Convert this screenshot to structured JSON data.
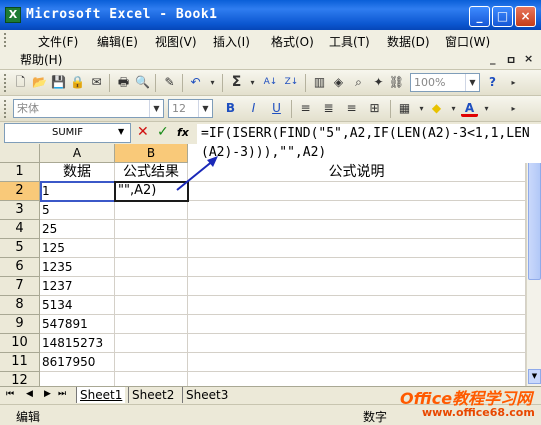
{
  "window": {
    "title": "Microsoft Excel - Book1",
    "icon": "excel-icon",
    "buttons": [
      "_",
      "□",
      "×"
    ]
  },
  "menubar": {
    "items": [
      "文件(F)",
      "编辑(E)",
      "视图(V)",
      "插入(I)",
      "格式(O)",
      "工具(T)",
      "数据(D)",
      "窗口(W)",
      "帮助(H)"
    ],
    "mdi_buttons": [
      "_",
      "ㅁ",
      "×"
    ]
  },
  "toolbar_standard": {
    "icons": [
      "new-icon",
      "open-icon",
      "save-icon",
      "permission-icon",
      "print-icon",
      "print-preview-icon",
      "format-painter-icon",
      "undo-icon",
      "autosum-icon",
      "sort-ascending-icon",
      "sort-descending-icon",
      "chart-wizard-icon",
      "drawing-icon",
      "help-icon"
    ],
    "zoom": "100%"
  },
  "toolbar_formatting": {
    "font": "宋体",
    "size": "12",
    "bold": "B",
    "italic": "I",
    "underline": "U",
    "font_color": "A"
  },
  "formula_bar": {
    "name_box": "SUMIF",
    "cancel": "✕",
    "enter": "✓",
    "fx": "fx",
    "formula": "=IF(ISERR(FIND(\"5\",A2,IF(LEN(A2)-3<1,1,LEN(A2)-3))),\"\",A2)"
  },
  "sheet": {
    "columns": [
      "A",
      "B"
    ],
    "rows": [
      "1",
      "2",
      "3",
      "4",
      "5",
      "6",
      "7",
      "8",
      "9",
      "10",
      "11",
      "12"
    ],
    "header_row": {
      "A": "数据",
      "B": "公式结果",
      "C": "公式说明"
    },
    "column_a_values": [
      "1",
      "5",
      "25",
      "125",
      "1235",
      "1237",
      "5134",
      "547891",
      "14815273",
      "8617950",
      ""
    ],
    "edit_cell_text": "\"\",A2)"
  },
  "sheet_tabs": {
    "nav": [
      "⏮",
      "◀",
      "▶",
      "⏭"
    ],
    "tabs": [
      "Sheet1",
      "Sheet2",
      "Sheet3"
    ]
  },
  "statusbar": {
    "mode": "编辑",
    "indicator": "数字"
  },
  "watermark": {
    "line1": "Office教程学习网",
    "line2": "www.office68.com"
  }
}
